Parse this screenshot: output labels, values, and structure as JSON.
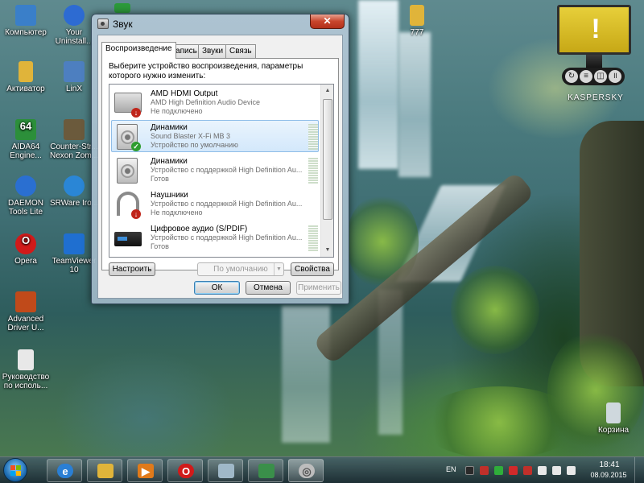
{
  "desktop": {
    "icons": [
      {
        "label": "Компьютер",
        "icon": "computer-icon",
        "color": "#3a7fc9"
      },
      {
        "label": "Your Uninstall...",
        "icon": "uninstaller-icon",
        "color": "#2d6bd2"
      },
      {
        "label": "Активатор",
        "icon": "folder-icon",
        "color": "#e0b43a"
      },
      {
        "label": "LinX",
        "icon": "linx-icon",
        "color": "#4d7fc0"
      },
      {
        "label": "AIDA64 Engine...",
        "icon": "aida64-icon",
        "color": "#2c8f3a"
      },
      {
        "label": "Counter-Str... Nexon Zom...",
        "icon": "game-icon",
        "color": "#6b5a3c"
      },
      {
        "label": "DAEMON Tools Lite",
        "icon": "daemon-tools-icon",
        "color": "#2a6fd1"
      },
      {
        "label": "SRWare Iro...",
        "icon": "browser-icon",
        "color": "#2a86d6"
      },
      {
        "label": "Opera",
        "icon": "opera-icon",
        "color": "#d11a1a"
      },
      {
        "label": "TeamViewer 10",
        "icon": "teamviewer-icon",
        "color": "#1f6fd0"
      },
      {
        "label": "Advanced Driver U...",
        "icon": "driver-updater-icon",
        "color": "#c04a1a"
      },
      {
        "label": "Руководство по исполь...",
        "icon": "document-icon",
        "color": "#e8e8e8"
      },
      {
        "label": "777",
        "icon": "folder-icon",
        "color": "#e0b43a"
      },
      {
        "label": "Корзина",
        "icon": "recycle-bin-icon",
        "color": "#cfd8dd"
      }
    ]
  },
  "kaspersky": {
    "brand": "KASPERSKY",
    "warning_glyph": "!",
    "color": "#d9bd27"
  },
  "dialog": {
    "title": "Звук",
    "close_glyph": "✕",
    "tabs": [
      "Воспроизведение",
      "Запись",
      "Звуки",
      "Связь"
    ],
    "active_tab": "Воспроизведение",
    "prompt": "Выберите устройство воспроизведения, параметры которого нужно изменить:",
    "devices": [
      {
        "name": "AMD HDMI Output",
        "driver": "AMD High Definition Audio Device",
        "status": "Не подключено",
        "icon": "monitor-icon",
        "badge": "red",
        "selected": false,
        "meter": false
      },
      {
        "name": "Динамики",
        "driver": "Sound Blaster X-Fi MB 3",
        "status": "Устройство по умолчанию",
        "icon": "speaker-icon",
        "badge": "green",
        "selected": true,
        "meter": true
      },
      {
        "name": "Динамики",
        "driver": "Устройство с поддержкой High Definition Au...",
        "status": "Готов",
        "icon": "speaker-icon",
        "badge": "",
        "selected": false,
        "meter": true
      },
      {
        "name": "Наушники",
        "driver": "Устройство с поддержкой High Definition Au...",
        "status": "Не подключено",
        "icon": "headphones-icon",
        "badge": "red",
        "selected": false,
        "meter": false
      },
      {
        "name": "Цифровое аудио (S/PDIF)",
        "driver": "Устройство с поддержкой High Definition Au...",
        "status": "Готов",
        "icon": "spdif-icon",
        "badge": "",
        "selected": false,
        "meter": true
      }
    ],
    "buttons": {
      "configure": "Настроить",
      "default": "По умолчанию",
      "properties": "Свойства",
      "ok": "ОК",
      "cancel": "Отмена",
      "apply": "Применить"
    }
  },
  "taskbar": {
    "apps": [
      {
        "name": "ie-icon",
        "color": "#2a7fd4",
        "glyph": "e"
      },
      {
        "name": "explorer-icon",
        "color": "#e0b43a",
        "glyph": ""
      },
      {
        "name": "media-player-icon",
        "color": "#e07a1a",
        "glyph": "▶"
      },
      {
        "name": "opera-icon",
        "color": "#d11a1a",
        "glyph": "O"
      },
      {
        "name": "window-icon",
        "color": "#9fb8c8",
        "glyph": ""
      },
      {
        "name": "monitor-app-icon",
        "color": "#3a8f4a",
        "glyph": ""
      },
      {
        "name": "sound-icon",
        "color": "#bdbdbd",
        "glyph": "◎"
      }
    ],
    "tray": {
      "language": "EN",
      "time": "18:41",
      "date": "08.09.2015",
      "icons": [
        {
          "name": "tray-app-icon",
          "color": "#2a2a2a"
        },
        {
          "name": "tray-network-off-icon",
          "color": "#c0302a"
        },
        {
          "name": "tray-green-icon",
          "color": "#2fae3a"
        },
        {
          "name": "tray-red-icon",
          "color": "#d12a2a"
        },
        {
          "name": "tray-en-icon",
          "color": "#c0302a"
        },
        {
          "name": "tray-flag-icon",
          "color": "#e8e8e8"
        },
        {
          "name": "tray-volume-icon",
          "color": "#e8e8e8"
        },
        {
          "name": "tray-speaker-icon",
          "color": "#e8e8e8"
        }
      ]
    }
  }
}
